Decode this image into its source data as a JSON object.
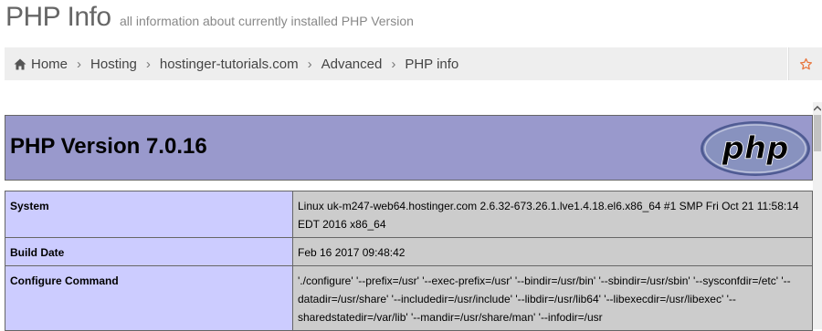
{
  "header": {
    "title": "PHP Info",
    "subtitle": "all information about currently installed PHP Version"
  },
  "breadcrumb": {
    "items": [
      {
        "label": "Home",
        "icon": "home-icon"
      },
      {
        "label": "Hosting"
      },
      {
        "label": "hostinger-tutorials.com"
      },
      {
        "label": "Advanced"
      },
      {
        "label": "PHP info"
      }
    ],
    "star_icon": "star-icon"
  },
  "phpinfo": {
    "version": "PHP Version 7.0.16",
    "logo_text": "php",
    "rows": [
      {
        "key": "System",
        "value": "Linux uk-m247-web64.hostinger.com 2.6.32-673.26.1.lve1.4.18.el6.x86_64 #1 SMP Fri Oct 21 11:58:14 EDT 2016 x86_64"
      },
      {
        "key": "Build Date",
        "value": "Feb 16 2017 09:48:42"
      },
      {
        "key": "Configure Command",
        "value": "'./configure' '--prefix=/usr' '--exec-prefix=/usr' '--bindir=/usr/bin' '--sbindir=/usr/sbin' '--sysconfdir=/etc' '--datadir=/usr/share' '--includedir=/usr/include' '--libdir=/usr/lib64' '--libexecdir=/usr/libexec' '--sharedstatedir=/var/lib' '--mandir=/usr/share/man' '--infodir=/usr"
      }
    ]
  },
  "colors": {
    "header_bg": "#9999cc",
    "key_bg": "#ccccff",
    "value_bg": "#cccccc",
    "breadcrumb_bg": "#eeeeee",
    "star": "#e8743b"
  }
}
